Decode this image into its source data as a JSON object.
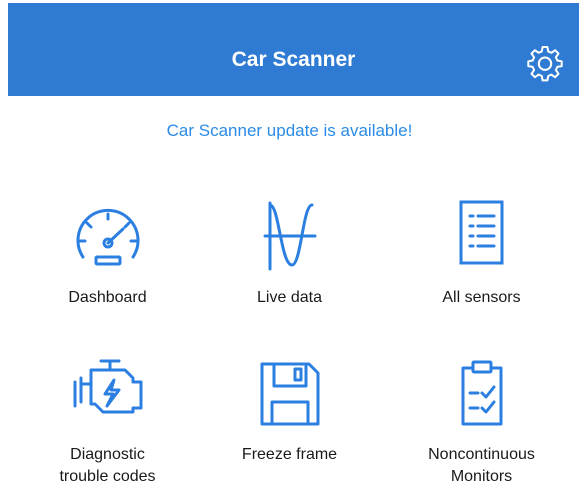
{
  "header": {
    "title": "Car Scanner",
    "settings_icon": "gear-icon"
  },
  "banner": {
    "text": "Car Scanner update is available!"
  },
  "colors": {
    "header_bg": "#2f7bd3",
    "accent": "#2b8be6",
    "icon": "#2b7fe0"
  },
  "tiles": [
    {
      "label": "Dashboard",
      "icon": "speedometer-icon"
    },
    {
      "label": "Live data",
      "icon": "waveform-icon"
    },
    {
      "label": "All sensors",
      "icon": "list-icon"
    },
    {
      "label": "Diagnostic\ntrouble codes",
      "icon": "engine-icon"
    },
    {
      "label": "Freeze frame",
      "icon": "floppy-disk-icon"
    },
    {
      "label": "Noncontinuous\nMonitors",
      "icon": "clipboard-check-icon"
    }
  ]
}
